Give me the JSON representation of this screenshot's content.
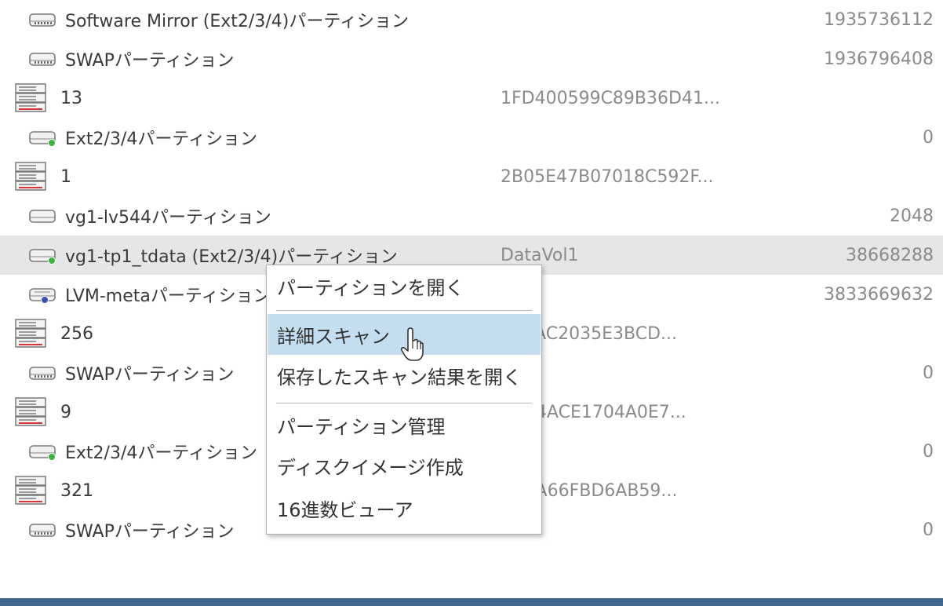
{
  "rows": [
    {
      "type": "part",
      "icon": "swap-drive-icon",
      "name": "Software Mirror (Ext2/3/4)パーティション",
      "col2": "",
      "col3": "1935736112"
    },
    {
      "type": "part",
      "icon": "swap-drive-icon",
      "name": "SWAPパーティション",
      "col2": "",
      "col3": "1936796408"
    },
    {
      "type": "disk",
      "icon": "disk-server-icon",
      "name": "13",
      "col2": "1FD400599C89B36D41...",
      "col3": ""
    },
    {
      "type": "part",
      "icon": "ext-drive-icon",
      "name": "Ext2/3/4パーティション",
      "col2": "",
      "col3": "0"
    },
    {
      "type": "disk",
      "icon": "disk-server-icon",
      "name": "1",
      "col2": "2B05E47B07018C592F...",
      "col3": ""
    },
    {
      "type": "part",
      "icon": "plain-drive-icon",
      "name": "vg1-lv544パーティション",
      "col2": "",
      "col3": "2048"
    },
    {
      "type": "part",
      "icon": "ext-drive-icon",
      "name": "vg1-tp1_tdata (Ext2/3/4)パーティション",
      "col2": "DataVol1",
      "col3": "38668288",
      "selected": true
    },
    {
      "type": "part",
      "icon": "lvm-drive-icon",
      "name": "LVM-metaパーティション",
      "col2": "",
      "col3": "3833669632"
    },
    {
      "type": "disk",
      "icon": "disk-server-icon",
      "name": "256",
      "col2": "3B5AC2035E3BCD...",
      "col3": ""
    },
    {
      "type": "part",
      "icon": "swap-drive-icon",
      "name": "SWAPパーティション",
      "col2": "",
      "col3": "0"
    },
    {
      "type": "disk",
      "icon": "disk-server-icon",
      "name": "9",
      "col2": "2D94ACE1704A0E7...",
      "col3": ""
    },
    {
      "type": "part",
      "icon": "ext-drive-icon",
      "name": "Ext2/3/4パーティション",
      "col2": "",
      "col3": "0"
    },
    {
      "type": "disk",
      "icon": "disk-server-icon",
      "name": "321",
      "col2": "97DA66FBD6AB59...",
      "col3": ""
    },
    {
      "type": "part",
      "icon": "swap-drive-icon",
      "name": "SWAPパーティション",
      "col2": "",
      "col3": "0"
    }
  ],
  "context_menu": {
    "items": [
      {
        "label": "パーティションを開く",
        "name": "menu-open-partition"
      },
      {
        "separator": true
      },
      {
        "label": "詳細スキャン",
        "name": "menu-detailed-scan",
        "hover": true
      },
      {
        "label": "保存したスキャン結果を開く",
        "name": "menu-open-saved-scan"
      },
      {
        "separator": true
      },
      {
        "label": "パーティション管理",
        "name": "menu-partition-management"
      },
      {
        "label": "ディスクイメージ作成",
        "name": "menu-create-disk-image"
      },
      {
        "label": "16進数ビューア",
        "name": "menu-hex-viewer"
      }
    ]
  },
  "colors": {
    "selected_row": "#e6e6e6",
    "menu_hover": "#c5deef",
    "bottom_bar": "#3f6a8d",
    "disk_red": "#d9373a",
    "ext_green": "#3cb43c",
    "lvm_blue": "#3a4fb8"
  }
}
